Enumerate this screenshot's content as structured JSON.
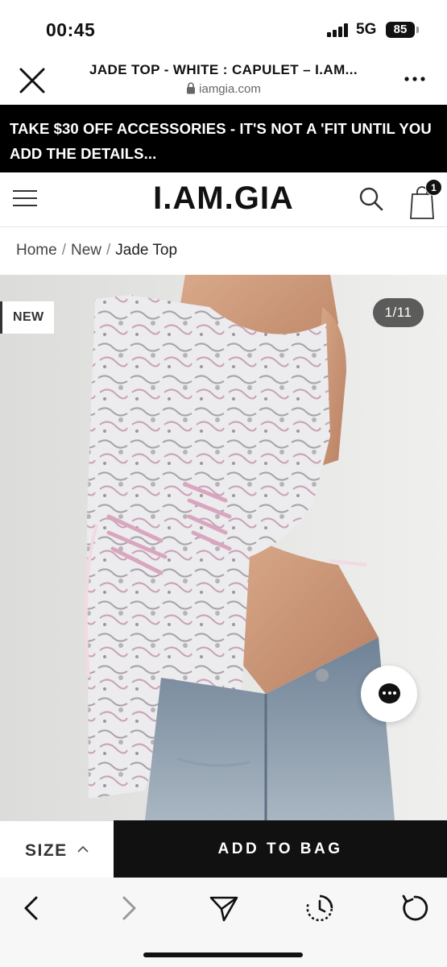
{
  "status_bar": {
    "time": "00:45",
    "network": "5G",
    "battery": "85"
  },
  "browser": {
    "page_title": "JADE TOP - WHITE : CAPULET – I.AM...",
    "url": "iamgia.com",
    "close_icon": "close-icon",
    "more_icon": "more-icon"
  },
  "promo": {
    "text": "TAKE $30 OFF ACCESSORIES - IT'S NOT A 'FIT UNTIL YOU ADD THE DETAILS..."
  },
  "site_header": {
    "logo": "I.AM.GIA",
    "bag_count": "1"
  },
  "breadcrumb": {
    "items": [
      "Home",
      "New",
      "Jade Top"
    ],
    "separator": "/"
  },
  "product": {
    "badge": "NEW",
    "image_counter": "1/11"
  },
  "actions": {
    "size_label": "SIZE",
    "add_to_bag_label": "ADD TO BAG"
  },
  "colors": {
    "promo_bg": "#000000",
    "add_button_bg": "#111111",
    "photo_bg": "#e7e7e5"
  }
}
